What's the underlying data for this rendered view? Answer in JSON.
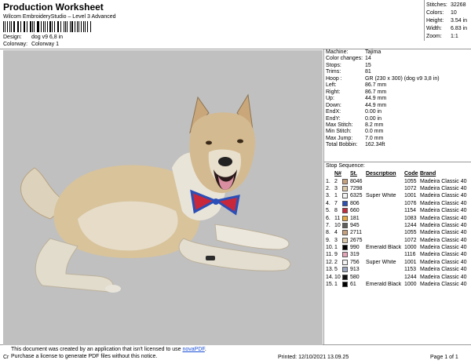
{
  "header": {
    "title": "Production Worksheet",
    "app": "Wilcom EmbroideryStudio – Level 3 Advanced",
    "design_label": "Design:",
    "design_value": "dog v9 6,8 in",
    "colorway_label": "Colorway:",
    "colorway_value": "Colorway 1"
  },
  "stats": [
    {
      "label": "Stitches:",
      "value": "32268"
    },
    {
      "label": "Colors:",
      "value": "10"
    },
    {
      "label": "Height:",
      "value": "3.54 in"
    },
    {
      "label": "Width:",
      "value": "6.83 in"
    },
    {
      "label": "Zoom:",
      "value": "1:1"
    }
  ],
  "info": [
    {
      "label": "Machine:",
      "value": "Tajima"
    },
    {
      "label": "Color changes:",
      "value": "14"
    },
    {
      "label": "Stops:",
      "value": "15"
    },
    {
      "label": "Trims:",
      "value": "81"
    },
    {
      "label": "Hoop :",
      "value": "GR (230 x 300) (dog v9 3,8 in)"
    },
    {
      "label": "Left:",
      "value": "86.7 mm"
    },
    {
      "label": "Right:",
      "value": "86.7 mm"
    },
    {
      "label": "Up:",
      "value": "44.9 mm"
    },
    {
      "label": "Down:",
      "value": "44.9 mm"
    },
    {
      "label": "EndX:",
      "value": "0.00 in"
    },
    {
      "label": "EndY:",
      "value": "0.00 in"
    },
    {
      "label": "Max Stitch:",
      "value": "8.2 mm"
    },
    {
      "label": "Min Stitch:",
      "value": "0.0 mm"
    },
    {
      "label": "Max Jump:",
      "value": "7.0 mm"
    },
    {
      "label": "Total Bobbin:",
      "value": "162.34ft"
    }
  ],
  "sequence": {
    "title": "Stop Sequence:",
    "headers": {
      "n": "N#",
      "st": "St.",
      "desc": "Description",
      "code": "Code",
      "brand": "Brand"
    },
    "rows": [
      {
        "num": "1.",
        "n": "2",
        "color": "#c9a27c",
        "st": "8046",
        "desc": "",
        "code": "1055",
        "brand": "Madeira Classic 40"
      },
      {
        "num": "2.",
        "n": "3",
        "color": "#dcc9a6",
        "st": "7298",
        "desc": "",
        "code": "1072",
        "brand": "Madeira Classic 40"
      },
      {
        "num": "3.",
        "n": "1",
        "color": "#f4f4f4",
        "st": "6325",
        "desc": "Super White",
        "code": "1001",
        "brand": "Madeira Classic 40"
      },
      {
        "num": "4.",
        "n": "7",
        "color": "#2a4fb8",
        "st": "806",
        "desc": "",
        "code": "1076",
        "brand": "Madeira Classic 40"
      },
      {
        "num": "5.",
        "n": "8",
        "color": "#c8283a",
        "st": "660",
        "desc": "",
        "code": "1154",
        "brand": "Madeira Classic 40"
      },
      {
        "num": "6.",
        "n": "11",
        "color": "#e8a83a",
        "st": "181",
        "desc": "",
        "code": "1083",
        "brand": "Madeira Classic 40"
      },
      {
        "num": "7.",
        "n": "10",
        "color": "#5e5e5e",
        "st": "945",
        "desc": "",
        "code": "1244",
        "brand": "Madeira Classic 40"
      },
      {
        "num": "8.",
        "n": "4",
        "color": "#c9a27c",
        "st": "2711",
        "desc": "",
        "code": "1055",
        "brand": "Madeira Classic 40"
      },
      {
        "num": "9.",
        "n": "3",
        "color": "#dcc9a6",
        "st": "2675",
        "desc": "",
        "code": "1072",
        "brand": "Madeira Classic 40"
      },
      {
        "num": "10.",
        "n": "1",
        "color": "#000000",
        "st": "990",
        "desc": "Emerald Black",
        "code": "1000",
        "brand": "Madeira Classic 40"
      },
      {
        "num": "11.",
        "n": "9",
        "color": "#e7a4b8",
        "st": "319",
        "desc": "",
        "code": "1116",
        "brand": "Madeira Classic 40"
      },
      {
        "num": "12.",
        "n": "2",
        "color": "#f4f4f4",
        "st": "756",
        "desc": "Super White",
        "code": "1001",
        "brand": "Madeira Classic 40"
      },
      {
        "num": "13.",
        "n": "5",
        "color": "#9aa6bf",
        "st": "913",
        "desc": "",
        "code": "1153",
        "brand": "Madeira Classic 40"
      },
      {
        "num": "14.",
        "n": "10",
        "color": "#111111",
        "st": "580",
        "desc": "",
        "code": "1244",
        "brand": "Madeira Classic 40"
      },
      {
        "num": "15.",
        "n": "1",
        "color": "#000000",
        "st": "61",
        "desc": "Emerald Black",
        "code": "1000",
        "brand": "Madeira Classic 40"
      }
    ]
  },
  "footer": {
    "notice_line1": "This document was created by an application that isn't licensed to use ",
    "notice_link": "novaPDF",
    "notice_line2": "Purchase a license to generate PDF files without this notice.",
    "cr": "Cr",
    "printed": "Printed: 12/10/2021 13.09.25",
    "page": "Page 1 of 1"
  },
  "colors": {
    "design_background": "#c0c0c0",
    "dog_fur": "#d2b98e",
    "dog_light": "#e8e2d4",
    "bowtie_blue": "#2a4fb8",
    "bowtie_red": "#c8283a"
  }
}
